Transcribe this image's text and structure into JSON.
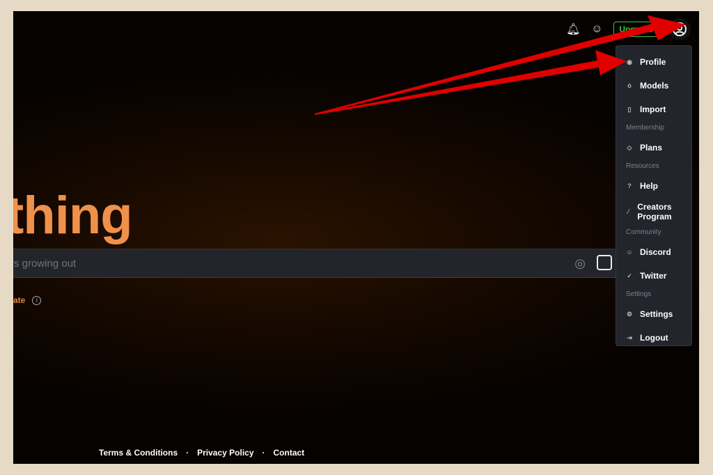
{
  "topbar": {
    "upgrade_label": "Upgrade",
    "icons": [
      "bell-icon",
      "discord-icon",
      "user-circle-icon"
    ]
  },
  "hero": {
    "title_fragment": "thing"
  },
  "prompt": {
    "placeholder_fragment": "rs growing out"
  },
  "option": {
    "label_fragment": "ate"
  },
  "menu": {
    "items": [
      {
        "label": "Profile",
        "icon": "user-icon"
      },
      {
        "label": "Models",
        "icon": "models-icon"
      },
      {
        "label": "Import",
        "icon": "import-icon"
      }
    ],
    "membership": {
      "heading": "Membership",
      "items": [
        {
          "label": "Plans",
          "icon": "tag-icon"
        }
      ]
    },
    "resources": {
      "heading": "Resources",
      "items": [
        {
          "label": "Help",
          "icon": "help-icon"
        },
        {
          "label": "Creators Program",
          "icon": "brush-icon"
        }
      ]
    },
    "community": {
      "heading": "Community",
      "items": [
        {
          "label": "Discord",
          "icon": "discord-icon"
        },
        {
          "label": "Twitter",
          "icon": "twitter-icon"
        }
      ]
    },
    "settings": {
      "heading": "Settings",
      "items": [
        {
          "label": "Settings",
          "icon": "gear-icon"
        },
        {
          "label": "Logout",
          "icon": "logout-icon"
        }
      ]
    }
  },
  "footer": {
    "links": [
      "Terms & Conditions",
      "Privacy Policy",
      "Contact"
    ],
    "separator": "·"
  },
  "colors": {
    "accent": "#f0914a",
    "upgrade": "#3fbf4a",
    "menu_bg": "#22252b",
    "arrow": "#e00000"
  }
}
